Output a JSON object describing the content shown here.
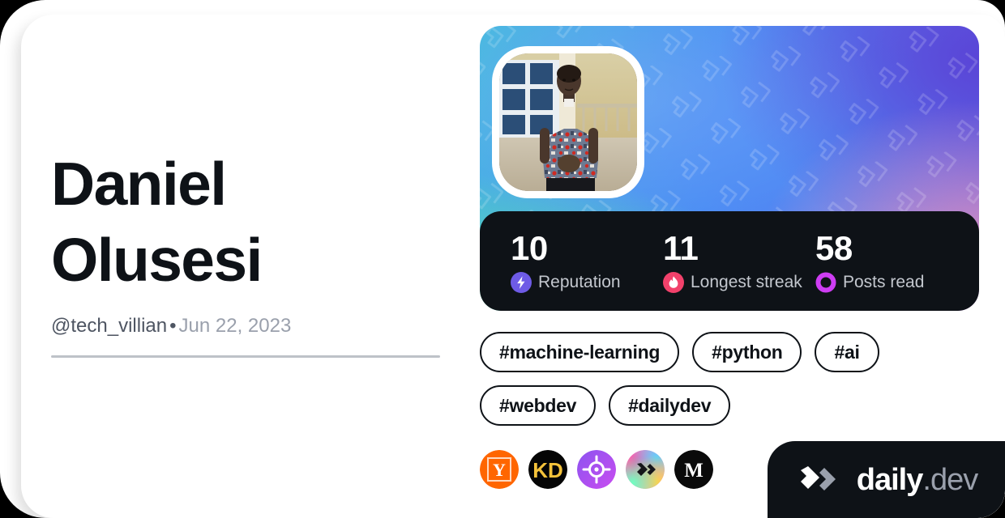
{
  "profile": {
    "display_name": "Daniel Olusesi",
    "handle": "@tech_villian",
    "separator": "•",
    "joined_date": "Jun 22, 2023",
    "avatar_alt": "profile-photo"
  },
  "stats": [
    {
      "value": "10",
      "label": "Reputation",
      "icon": "reputation-bolt-icon",
      "color": "#6E5BE6"
    },
    {
      "value": "11",
      "label": "Longest streak",
      "icon": "streak-flame-icon",
      "color": "#F2416B"
    },
    {
      "value": "58",
      "label": "Posts read",
      "icon": "posts-read-ring-icon",
      "color": "#CE3DF3"
    }
  ],
  "tags": [
    {
      "label": "#machine-learning"
    },
    {
      "label": "#python"
    },
    {
      "label": "#ai"
    },
    {
      "label": "#webdev"
    },
    {
      "label": "#dailydev"
    }
  ],
  "sources": [
    {
      "name": "hacker-news-source-icon"
    },
    {
      "name": "kdnuggets-source-icon"
    },
    {
      "name": "crosshair-source-icon"
    },
    {
      "name": "dailydev-source-icon"
    },
    {
      "name": "medium-source-icon"
    }
  ],
  "brand": {
    "name": "daily",
    "tld": ".dev",
    "logo": "dailydev-logo-icon"
  },
  "colors": {
    "card_background": "#FFFFFF",
    "page_background": "#000000",
    "text_primary": "#0E1217",
    "text_secondary": "#4E5562",
    "text_muted": "#9AA0AC",
    "stats_panel": "#0E1217",
    "divider": "#BEC2C8",
    "banner_gradient_start": "#45B6E0",
    "banner_gradient_end": "#5A46D6"
  }
}
